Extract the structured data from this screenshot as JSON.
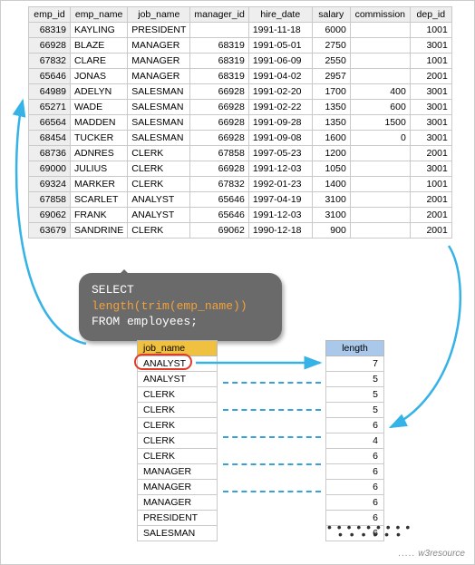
{
  "emp_table": {
    "headers": [
      "emp_id",
      "emp_name",
      "job_name",
      "manager_id",
      "hire_date",
      "salary",
      "commission",
      "dep_id"
    ],
    "rows": [
      {
        "emp_id": "68319",
        "emp_name": "KAYLING",
        "job_name": "PRESIDENT",
        "manager_id": "",
        "hire_date": "1991-11-18",
        "salary": "6000",
        "commission": "",
        "dep_id": "1001"
      },
      {
        "emp_id": "66928",
        "emp_name": "BLAZE",
        "job_name": "MANAGER",
        "manager_id": "68319",
        "hire_date": "1991-05-01",
        "salary": "2750",
        "commission": "",
        "dep_id": "3001"
      },
      {
        "emp_id": "67832",
        "emp_name": "CLARE",
        "job_name": "MANAGER",
        "manager_id": "68319",
        "hire_date": "1991-06-09",
        "salary": "2550",
        "commission": "",
        "dep_id": "1001"
      },
      {
        "emp_id": "65646",
        "emp_name": "JONAS",
        "job_name": "MANAGER",
        "manager_id": "68319",
        "hire_date": "1991-04-02",
        "salary": "2957",
        "commission": "",
        "dep_id": "2001"
      },
      {
        "emp_id": "64989",
        "emp_name": "ADELYN",
        "job_name": "SALESMAN",
        "manager_id": "66928",
        "hire_date": "1991-02-20",
        "salary": "1700",
        "commission": "400",
        "dep_id": "3001"
      },
      {
        "emp_id": "65271",
        "emp_name": "WADE",
        "job_name": "SALESMAN",
        "manager_id": "66928",
        "hire_date": "1991-02-22",
        "salary": "1350",
        "commission": "600",
        "dep_id": "3001"
      },
      {
        "emp_id": "66564",
        "emp_name": "MADDEN",
        "job_name": "SALESMAN",
        "manager_id": "66928",
        "hire_date": "1991-09-28",
        "salary": "1350",
        "commission": "1500",
        "dep_id": "3001"
      },
      {
        "emp_id": "68454",
        "emp_name": "TUCKER",
        "job_name": "SALESMAN",
        "manager_id": "66928",
        "hire_date": "1991-09-08",
        "salary": "1600",
        "commission": "0",
        "dep_id": "3001"
      },
      {
        "emp_id": "68736",
        "emp_name": "ADNRES",
        "job_name": "CLERK",
        "manager_id": "67858",
        "hire_date": "1997-05-23",
        "salary": "1200",
        "commission": "",
        "dep_id": "2001"
      },
      {
        "emp_id": "69000",
        "emp_name": "JULIUS",
        "job_name": "CLERK",
        "manager_id": "66928",
        "hire_date": "1991-12-03",
        "salary": "1050",
        "commission": "",
        "dep_id": "3001"
      },
      {
        "emp_id": "69324",
        "emp_name": "MARKER",
        "job_name": "CLERK",
        "manager_id": "67832",
        "hire_date": "1992-01-23",
        "salary": "1400",
        "commission": "",
        "dep_id": "1001"
      },
      {
        "emp_id": "67858",
        "emp_name": "SCARLET",
        "job_name": "ANALYST",
        "manager_id": "65646",
        "hire_date": "1997-04-19",
        "salary": "3100",
        "commission": "",
        "dep_id": "2001"
      },
      {
        "emp_id": "69062",
        "emp_name": "FRANK",
        "job_name": "ANALYST",
        "manager_id": "65646",
        "hire_date": "1991-12-03",
        "salary": "3100",
        "commission": "",
        "dep_id": "2001"
      },
      {
        "emp_id": "63679",
        "emp_name": "SANDRINE",
        "job_name": "CLERK",
        "manager_id": "69062",
        "hire_date": "1990-12-18",
        "salary": "900",
        "commission": "",
        "dep_id": "2001"
      }
    ]
  },
  "sql": {
    "line1_kw": "SELECT ",
    "line1_fn": "length(trim(emp_name))",
    "line2": "FROM employees;"
  },
  "job_table": {
    "header": "job_name",
    "rows": [
      "ANALYST",
      "ANALYST",
      "CLERK",
      "CLERK",
      "CLERK",
      "CLERK",
      "CLERK",
      "MANAGER",
      "MANAGER",
      "MANAGER",
      "PRESIDENT",
      "SALESMAN"
    ]
  },
  "length_table": {
    "header": "length",
    "rows": [
      "7",
      "5",
      "5",
      "5",
      "6",
      "4",
      "6",
      "6",
      "6",
      "6",
      "6",
      "6"
    ]
  },
  "watermark": "w3resource",
  "colors": {
    "arrow_blue": "#35b2e6",
    "highlight_red": "#e03a2a",
    "header_orange": "#f0c040",
    "header_blue": "#a9c8ea"
  }
}
